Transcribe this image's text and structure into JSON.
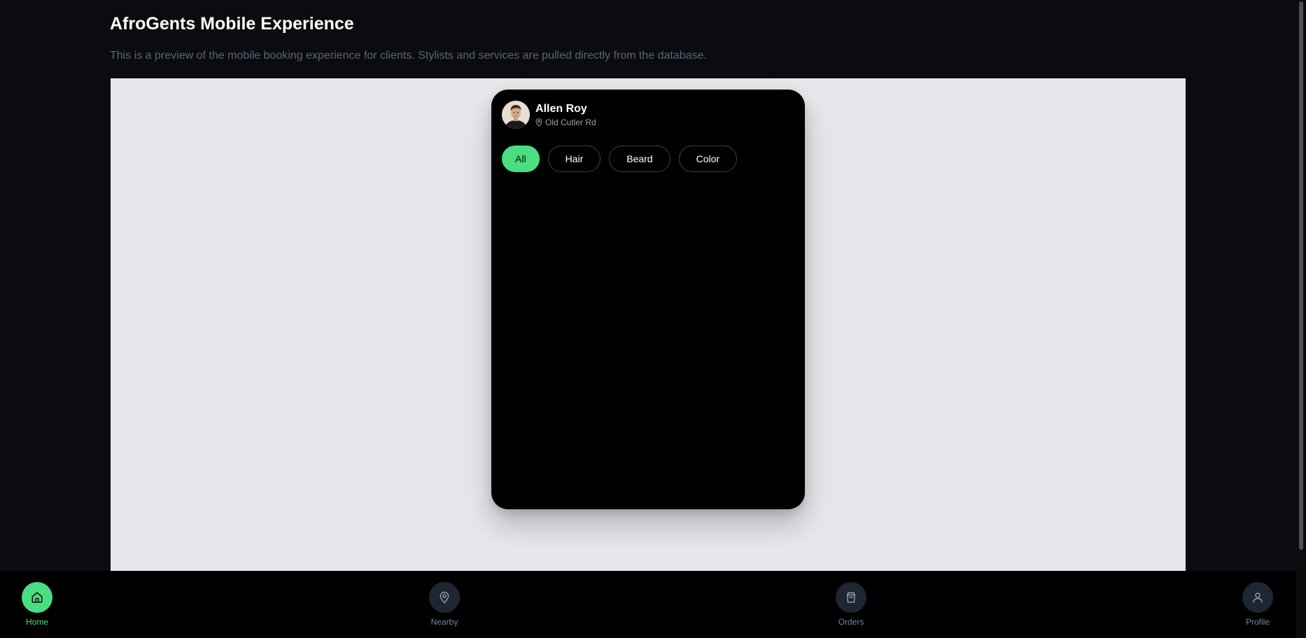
{
  "page": {
    "title": "AfroGents Mobile Experience",
    "subtitle": "This is a preview of the mobile booking experience for clients. Stylists and services are pulled directly from the database."
  },
  "phone": {
    "user": {
      "name": "Allen Roy",
      "location": "Old Cutler Rd",
      "avatar_icon": "user-avatar-photo"
    },
    "filters": [
      {
        "label": "All",
        "active": true
      },
      {
        "label": "Hair",
        "active": false
      },
      {
        "label": "Beard",
        "active": false
      },
      {
        "label": "Color",
        "active": false
      }
    ]
  },
  "bottom_nav": {
    "items": [
      {
        "label": "Home",
        "icon": "home-icon",
        "active": true
      },
      {
        "label": "Nearby",
        "icon": "map-pin-icon",
        "active": false
      },
      {
        "label": "Orders",
        "icon": "shopping-bag-icon",
        "active": false
      },
      {
        "label": "Profile",
        "icon": "user-icon",
        "active": false
      }
    ]
  },
  "colors": {
    "accent": "#4ade80",
    "background": "#0b0c0f",
    "preview_background": "#e5e7eb",
    "phone_background": "#000000"
  }
}
